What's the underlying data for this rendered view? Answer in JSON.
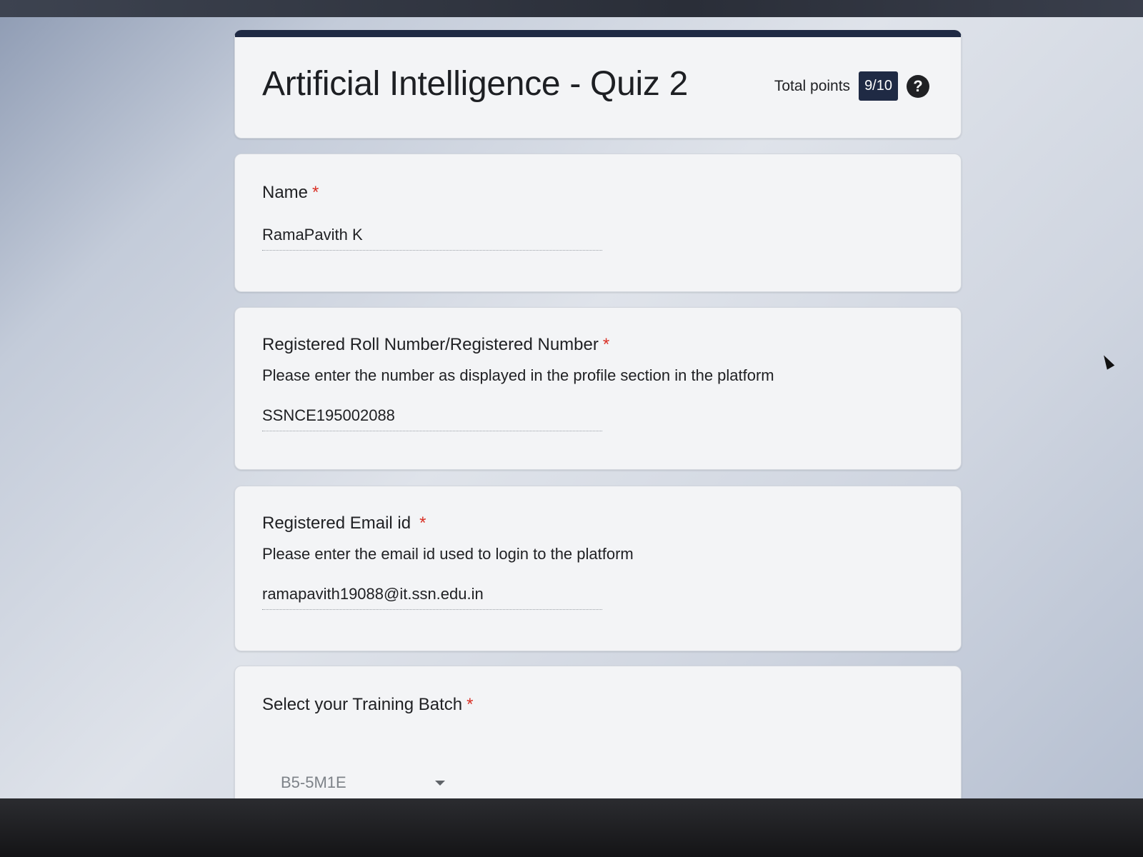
{
  "header": {
    "title": "Artificial Intelligence - Quiz 2",
    "points_label": "Total points",
    "points_value": "9/10",
    "help_icon": "?"
  },
  "questions": [
    {
      "label": "Name",
      "required": "*",
      "answer": "RamaPavith K"
    },
    {
      "label": "Registered Roll Number/Registered Number",
      "required": "*",
      "help": "Please enter the number as displayed in the profile section in the platform",
      "answer": "SSNCE195002088"
    },
    {
      "label": "Registered Email id",
      "required": "*",
      "help": "Please enter the email id used to login to the platform",
      "answer": "ramapavith19088@it.ssn.edu.in"
    },
    {
      "label": "Select your Training Batch",
      "required": "*",
      "selected": "B5-5M1E"
    }
  ],
  "colors": {
    "accent": "#1f2a44",
    "required": "#d93025",
    "card_bg": "#f3f4f6"
  }
}
